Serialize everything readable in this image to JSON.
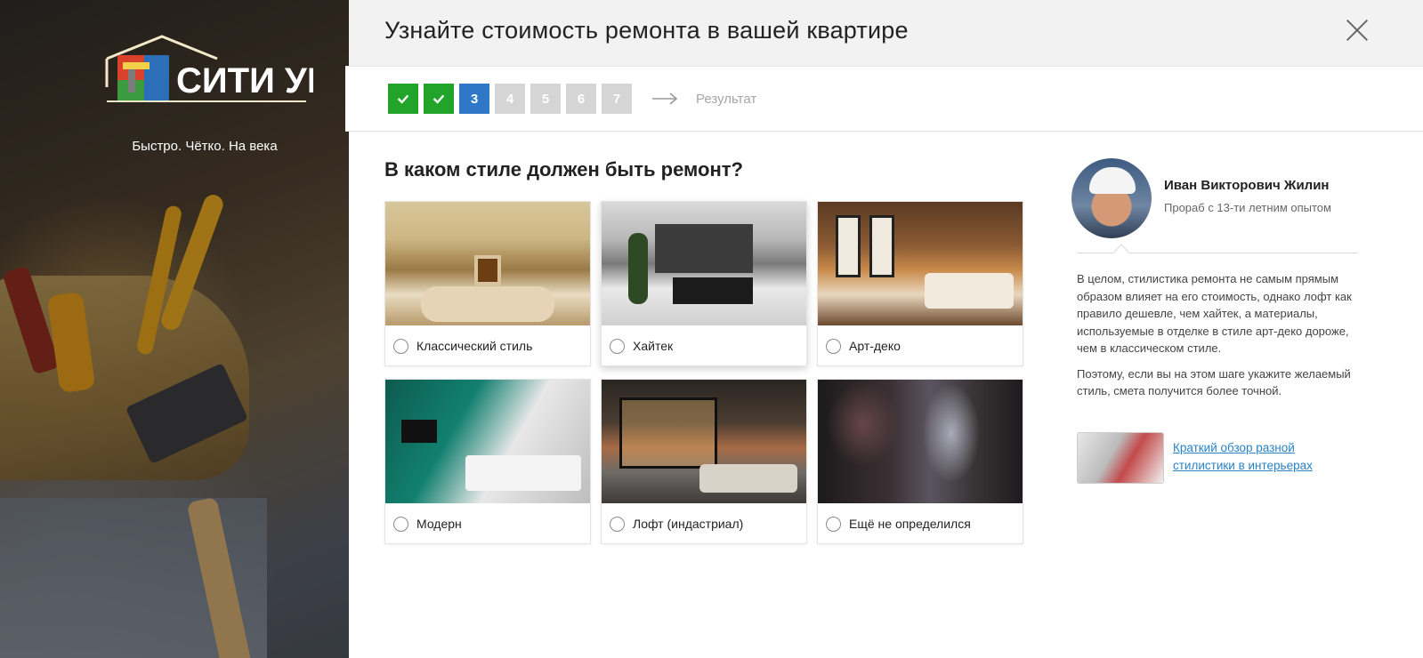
{
  "brand": {
    "logo_text": "СИТИ УЮТ",
    "tagline": "Быстро. Чётко. На века"
  },
  "header": {
    "title": "Узнайте стоимость ремонта в вашей квартире"
  },
  "steps": {
    "items": [
      "",
      "",
      "3",
      "4",
      "5",
      "6",
      "7"
    ],
    "current_step": 3,
    "completed_steps": 2,
    "total_steps": 7,
    "result_label": "Результат"
  },
  "question": {
    "title": "В каком стиле должен быть ремонт?",
    "options": [
      {
        "label": "Классический стиль"
      },
      {
        "label": "Хайтек"
      },
      {
        "label": "Арт-деко"
      },
      {
        "label": "Модерн"
      },
      {
        "label": "Лофт (индастриал)"
      },
      {
        "label": "Ещё не определился"
      }
    ]
  },
  "foreman": {
    "name": "Иван Викторович Жилин",
    "role": "Прораб с 13-ти летним опытом",
    "advice_1": "В целом, стилистика ремонта не самым прямым образом влияет на его стоимость, однако лофт как правило дешевле, чем хайтек, а материалы, используемые в отделке в стиле арт-деко дороже, чем в классическом стиле.",
    "advice_2": "Поэтому, если вы на этом шаге укажите желаемый стиль, смета получится более точной.",
    "review_link": "Краткий обзор разной стилистики в интерьерах"
  },
  "colors": {
    "done": "#22a32a",
    "current": "#2f78c8",
    "pending": "#d5d5d5",
    "link": "#2a82c7"
  }
}
